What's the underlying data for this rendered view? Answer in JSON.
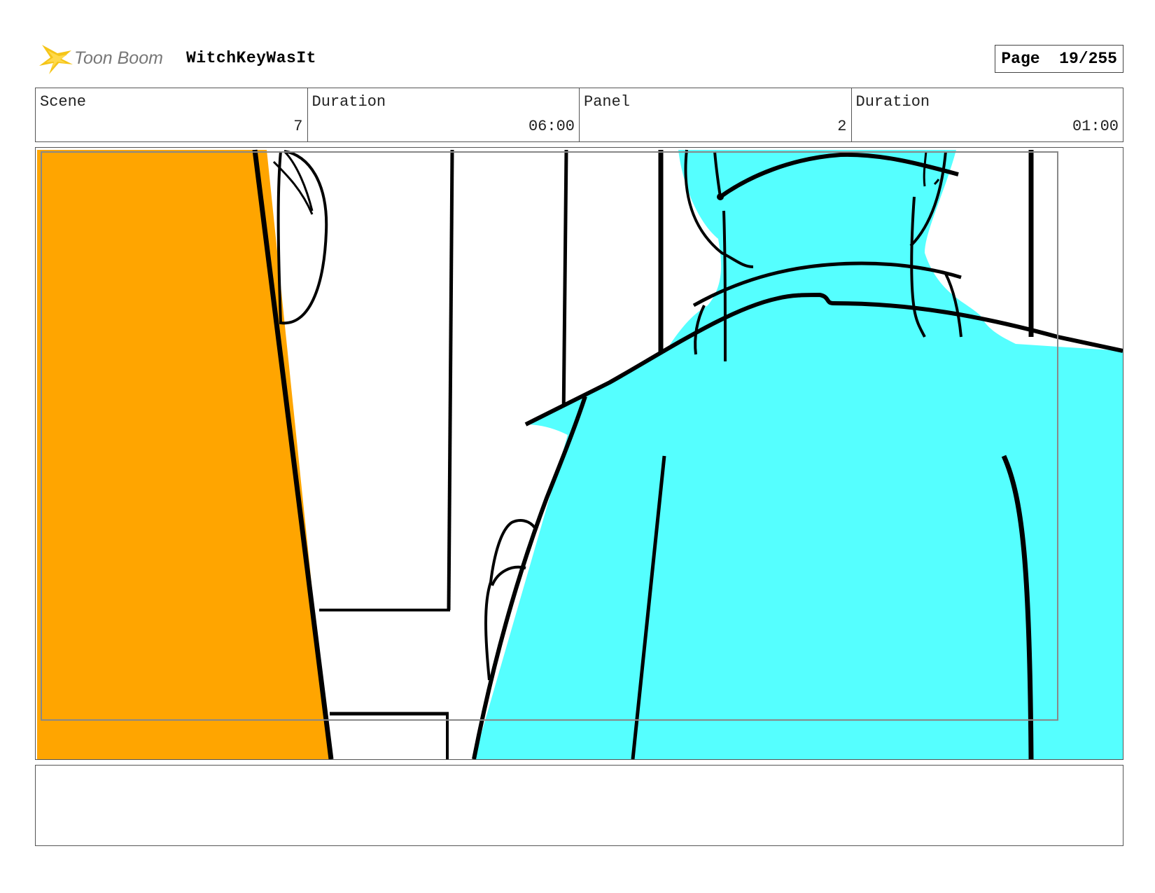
{
  "header": {
    "logo_text": "Toon Boom",
    "project_title": "WitchKeyWasIt",
    "page_label": "Page",
    "page_value": "19/255"
  },
  "info": {
    "scene_label": "Scene",
    "scene_value": "7",
    "scene_duration_label": "Duration",
    "scene_duration_value": "06:00",
    "panel_label": "Panel",
    "panel_value": "2",
    "panel_duration_label": "Duration",
    "panel_duration_value": "01:00"
  },
  "colors": {
    "orange": "#FFA500",
    "cyan": "#55FFFF",
    "logo_yellow": "#F5C518"
  },
  "notes": {
    "text": ""
  }
}
